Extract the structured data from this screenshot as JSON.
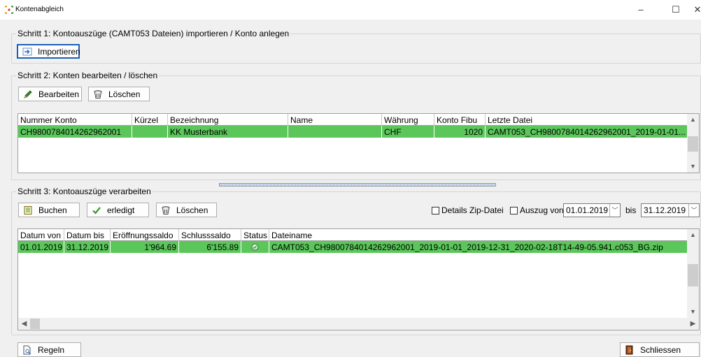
{
  "window": {
    "title": "Kontenabgleich",
    "controls": {
      "minimize": "–",
      "maximize": "☐",
      "close": "✕"
    }
  },
  "step1": {
    "title": "Schritt 1: Kontoauszüge (CAMT053 Dateien) importieren / Konto anlegen",
    "import_button": {
      "label": "Importieren",
      "icon": "import-arrow-icon"
    }
  },
  "step2": {
    "title": "Schritt 2: Konten bearbeiten / löschen",
    "edit_button": {
      "label": "Bearbeiten",
      "icon": "pencil-icon"
    },
    "delete_button": {
      "label": "Löschen",
      "icon": "trash-icon"
    },
    "grid": {
      "columns": [
        "Nummer Konto",
        "Kürzel",
        "Bezeichnung",
        "Name",
        "Währung",
        "Konto Fibu",
        "Letzte Datei"
      ],
      "rows": [
        {
          "nummer_konto": "CH9800784014262962001",
          "kuerzel": "",
          "bezeichnung": "KK Musterbank",
          "name": "",
          "waehrung": "CHF",
          "konto_fibu": "1020",
          "letzte_datei": "CAMT053_CH9800784014262962001_2019-01-01..."
        }
      ]
    }
  },
  "step3": {
    "title": "Schritt 3: Kontoauszüge verarbeiten",
    "book_button": {
      "label": "Buchen",
      "icon": "ledger-icon"
    },
    "done_button": {
      "label": "erledigt",
      "icon": "checkmark-icon"
    },
    "delete_button": {
      "label": "Löschen",
      "icon": "trash-icon"
    },
    "details_zip_label": "Details Zip-Datei",
    "details_zip_checked": false,
    "auszug_von_label": "Auszug von",
    "auszug_von_checked": false,
    "date_from": "01.01.2019",
    "bis_label": "bis",
    "date_to": "31.12.2019",
    "grid": {
      "columns": [
        "Datum von",
        "Datum bis",
        "Eröffnungssaldo",
        "Schlusssaldo",
        "Status",
        "Dateiname"
      ],
      "rows": [
        {
          "datum_von": "01.01.2019",
          "datum_bis": "31.12.2019",
          "eroeffnungssaldo": "1'964.69",
          "schlusssaldo": "6'155.89",
          "status_icon": "status-ok-icon",
          "dateiname": "CAMT053_CH9800784014262962001_2019-01-01_2019-12-31_2020-02-18T14-49-05.941.c053_BG.zip"
        }
      ]
    }
  },
  "footer": {
    "rules_button": {
      "label": "Regeln",
      "icon": "document-search-icon"
    },
    "close_button": {
      "label": "Schliessen",
      "icon": "exit-door-icon"
    }
  },
  "colors": {
    "selected_row": "#5bc75b",
    "focus_border": "#1a60b8",
    "app_icon": "#e8a000"
  }
}
